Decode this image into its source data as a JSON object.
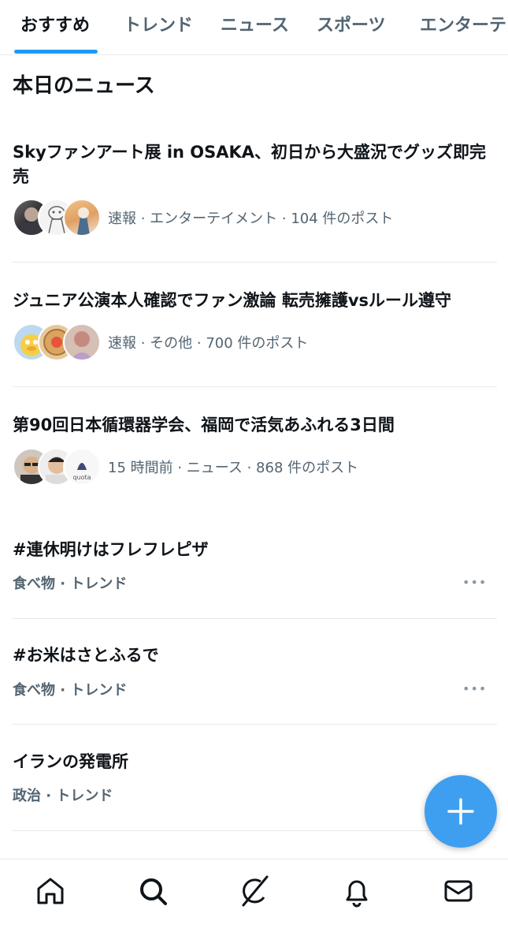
{
  "tabs": [
    {
      "label": "おすすめ"
    },
    {
      "label": "トレンド"
    },
    {
      "label": "ニュース"
    },
    {
      "label": "スポーツ"
    },
    {
      "label": "エンターテ"
    }
  ],
  "section_title": "本日のニュース",
  "news": [
    {
      "title": "Skyファンアート展 in OSAKA、初日から大盛況でグッズ即完売",
      "meta": "速報 · エンターテイメント · 104 件のポスト"
    },
    {
      "title": "ジュニア公演本人確認でファン激論 転売擁護vsルール遵守",
      "meta": "速報 · その他 · 700 件のポスト"
    },
    {
      "title": "第90回日本循環器学会、福岡で活気あふれる3日間",
      "meta": "15 時間前 · ニュース · 868 件のポスト"
    }
  ],
  "trends": [
    {
      "title": "#連休明けはフレフレピザ",
      "meta": "食べ物 · トレンド"
    },
    {
      "title": "#お米はさとふるで",
      "meta": "食べ物 · トレンド"
    },
    {
      "title": "イランの発電所",
      "meta": "政治 · トレンド"
    }
  ],
  "avatar_text": "quota",
  "more_glyph": "•••",
  "fab": {
    "icon": "plus-icon"
  },
  "bottom_nav": [
    {
      "icon": "home-icon"
    },
    {
      "icon": "search-icon"
    },
    {
      "icon": "grok-icon"
    },
    {
      "icon": "bell-icon"
    },
    {
      "icon": "mail-icon"
    }
  ],
  "colors": {
    "accent": "#1d9bf0",
    "fab": "#3e9ff0",
    "muted": "#536471"
  }
}
